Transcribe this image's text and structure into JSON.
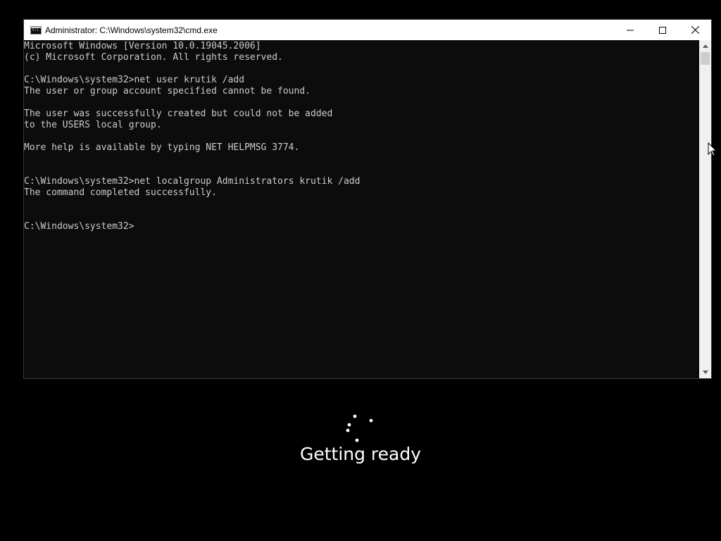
{
  "window": {
    "title": "Administrator: C:\\Windows\\system32\\cmd.exe",
    "icon": "cmd-icon",
    "icon_text": "C:\\",
    "controls": [
      "minimize-icon",
      "maximize-icon",
      "close-icon"
    ]
  },
  "console": {
    "lines": [
      "Microsoft Windows [Version 10.0.19045.2006]",
      "(c) Microsoft Corporation. All rights reserved.",
      "",
      "C:\\Windows\\system32>net user krutik /add",
      "The user or group account specified cannot be found.",
      "",
      "The user was successfully created but could not be added",
      "to the USERS local group.",
      "",
      "More help is available by typing NET HELPMSG 3774.",
      "",
      "",
      "C:\\Windows\\system32>net localgroup Administrators krutik /add",
      "The command completed successfully.",
      "",
      "",
      "C:\\Windows\\system32>"
    ]
  },
  "status": {
    "text": "Getting ready",
    "spinner_icon": "loading-spinner-icon"
  },
  "colors": {
    "background": "#000000",
    "console_bg": "#0c0c0c",
    "console_text": "#cccccc",
    "titlebar_bg": "#ffffff"
  }
}
